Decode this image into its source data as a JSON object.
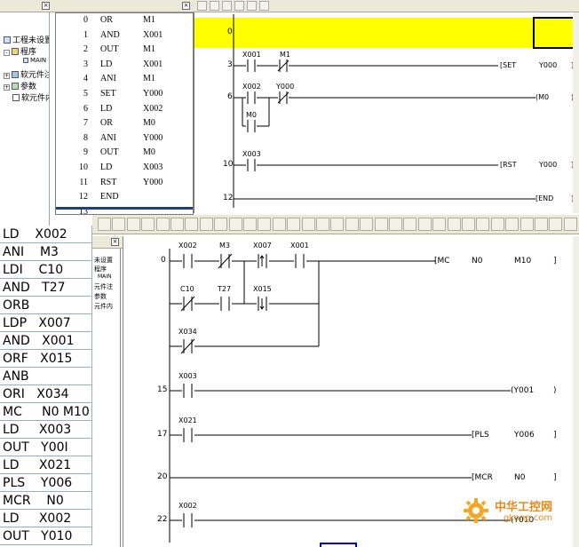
{
  "tree_top": {
    "items": [
      {
        "label": "工程未设置",
        "icon": "project-icon"
      },
      {
        "label": "程序",
        "icon": "folder-icon"
      },
      {
        "label": "MAIN",
        "icon": "program-icon"
      },
      {
        "label": "软元件注",
        "icon": "device-comment-icon"
      },
      {
        "label": "参数",
        "icon": "parameter-icon"
      },
      {
        "label": "软元件内",
        "icon": "device-memory-icon"
      }
    ]
  },
  "instructions": [
    {
      "step": "0",
      "op": "OR",
      "dev": "M1"
    },
    {
      "step": "1",
      "op": "AND",
      "dev": "X001"
    },
    {
      "step": "2",
      "op": "OUT",
      "dev": "M1"
    },
    {
      "step": "3",
      "op": "LD",
      "dev": "X001"
    },
    {
      "step": "4",
      "op": "ANI",
      "dev": "M1"
    },
    {
      "step": "5",
      "op": "SET",
      "dev": "Y000"
    },
    {
      "step": "6",
      "op": "LD",
      "dev": "X002"
    },
    {
      "step": "7",
      "op": "OR",
      "dev": "M0"
    },
    {
      "step": "8",
      "op": "ANI",
      "dev": "Y000"
    },
    {
      "step": "9",
      "op": "OUT",
      "dev": "M0"
    },
    {
      "step": "10",
      "op": "LD",
      "dev": "X003"
    },
    {
      "step": "11",
      "op": "RST",
      "dev": "Y000"
    },
    {
      "step": "12",
      "op": "END",
      "dev": ""
    },
    {
      "step": "13",
      "op": "",
      "dev": ""
    }
  ],
  "ladder_top": {
    "highlight_color": "#ffff00",
    "rungs": [
      {
        "step": "0"
      },
      {
        "step": "3",
        "contacts": [
          "X001",
          "M1"
        ],
        "instr": "SET",
        "arg": "Y000"
      },
      {
        "step": "6",
        "contacts": [
          "X002",
          "Y000",
          "M0"
        ],
        "instr": "M0",
        "arg": ""
      },
      {
        "step": "10",
        "contacts": [
          "X003"
        ],
        "instr": "RST",
        "arg": "Y000"
      },
      {
        "step": "12",
        "instr": "END"
      }
    ]
  },
  "tree_bottom": {
    "items": [
      "未设置",
      "程序",
      "MAIN",
      "元件注",
      "参数",
      "元件内"
    ]
  },
  "code_list": [
    "LD    X002",
    "ANI    M3",
    "LDI    C10",
    "AND   T27",
    "ORB",
    "LDP   X007",
    "AND   X001",
    "ORF   X015",
    "ANB",
    "ORI   X034",
    "MC     N0 M10",
    "LD     X003",
    "OUT   Y00I",
    "LD     X021",
    "PLS    Y006",
    "MCR    N0",
    "LD     X002",
    "OUT   Y010"
  ],
  "ladder_bottom": {
    "rung0": {
      "step": "0",
      "contacts": [
        "X002",
        "M3",
        "X007",
        "X001",
        "C10",
        "T27",
        "X015",
        "X034"
      ],
      "instr": "MC",
      "n": "N0",
      "arg": "M10"
    },
    "rung15": {
      "step": "15",
      "contact": "X003",
      "coil": "Y001"
    },
    "rung17": {
      "step": "17",
      "contact": "X021",
      "instr": "PLS",
      "arg": "Y006"
    },
    "rung20": {
      "step": "20",
      "instr": "MCR",
      "arg": "N0"
    },
    "rung22": {
      "step": "22",
      "contact": "X002",
      "coil": "Y010"
    }
  },
  "watermark": {
    "text": "中华工控网",
    "url": "gkong.com"
  }
}
